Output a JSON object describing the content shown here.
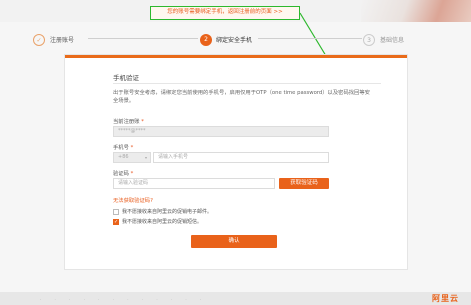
{
  "banner": {
    "notice": "您的账号需要绑定手机，返回注册前的页面 >>"
  },
  "steps": [
    {
      "number": "✓",
      "label": "注册账号",
      "state": "done"
    },
    {
      "number": "2",
      "label": "绑定安全手机",
      "state": "active"
    },
    {
      "number": "3",
      "label": "基础信息",
      "state": "pending"
    }
  ],
  "form": {
    "section_title": "手机验证",
    "description": "出于账号安全考虑，请绑定您当前使用的手机号，启用仅用于OTP（one time password）以及密码找回等安全场景。",
    "registered_email": {
      "label": "当前注册账",
      "required": "*",
      "value": "*****@****"
    },
    "phone": {
      "label": "手机号",
      "required": "*",
      "country_code": "+86",
      "placeholder": "请输入手机号"
    },
    "code": {
      "label": "验证码",
      "required": "*",
      "placeholder": "请输入验证码",
      "send_button": "获取验证码"
    },
    "no_code_link": "无法获取验证码?",
    "checkbox1": {
      "label": "我不愿接收来自阿里云的促销电子邮件。",
      "checked": false
    },
    "checkbox2": {
      "label": "我不愿接收来自阿里云的促销短信。",
      "checked": true
    },
    "submit": "确认"
  },
  "footer": {
    "logo": "阿里云"
  },
  "colors": {
    "accent": "#e9621a",
    "annotation": "#2db82d"
  }
}
